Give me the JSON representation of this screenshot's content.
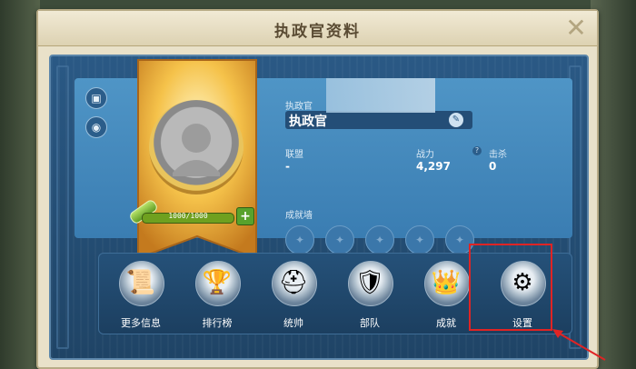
{
  "dialog": {
    "title": "执政官资料",
    "close_icon": "close-icon"
  },
  "profile": {
    "name_label": "执政官",
    "name_value": "执政官",
    "exp_text": "1000/1000",
    "alliance_label": "联盟",
    "alliance_value": "-",
    "power_label": "战力",
    "power_value": "4,297",
    "kills_label": "击杀",
    "kills_value": "0",
    "achievements_label": "成就墙",
    "achievement_slots": 5
  },
  "menu": [
    {
      "label": "更多信息",
      "icon": "scroll-icon"
    },
    {
      "label": "排行榜",
      "icon": "trophy-icon"
    },
    {
      "label": "统帅",
      "icon": "commander-helmet-icon"
    },
    {
      "label": "部队",
      "icon": "troops-icon"
    },
    {
      "label": "成就",
      "icon": "achievement-crown-icon"
    },
    {
      "label": "设置",
      "icon": "gear-icon"
    }
  ],
  "colors": {
    "panel_blue": "#3a7db2",
    "dialog_cream": "#e9e1c9",
    "highlight_red": "#e02424"
  }
}
